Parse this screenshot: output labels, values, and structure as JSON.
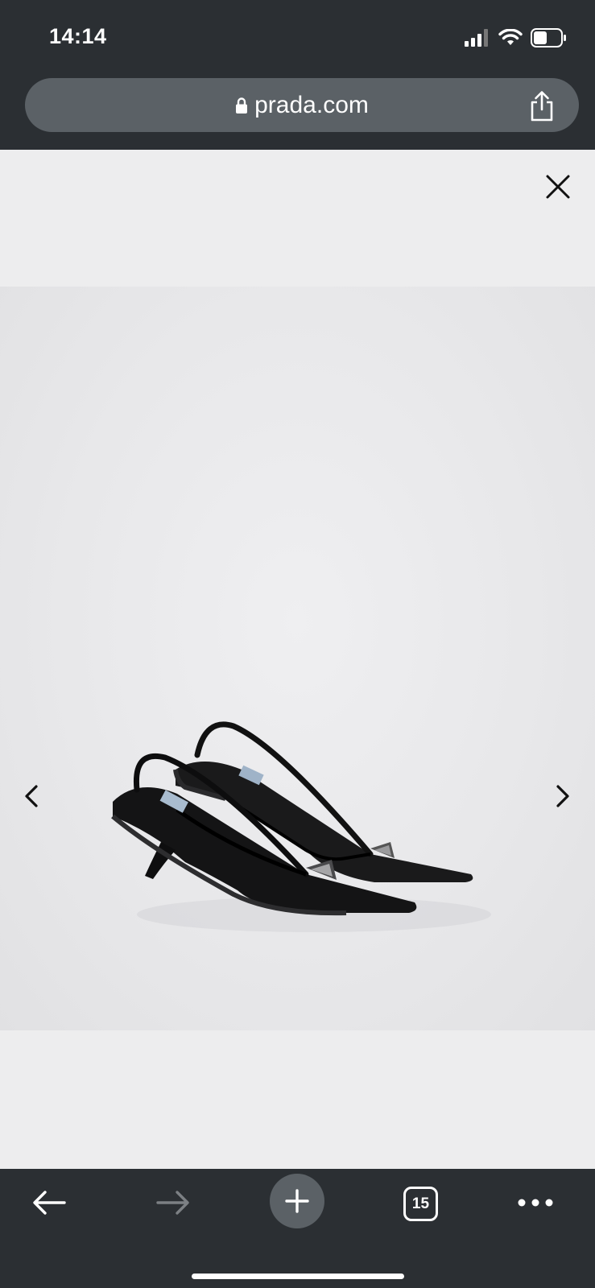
{
  "status_bar": {
    "time": "14:14",
    "icons": [
      "cellular-signal-icon",
      "wifi-icon",
      "battery-icon"
    ]
  },
  "browser": {
    "url": "prada.com",
    "lock_icon": "lock-icon",
    "share_icon": "share-icon"
  },
  "viewer": {
    "close_icon": "close-icon",
    "prev_icon": "chevron-left-icon",
    "next_icon": "chevron-right-icon",
    "image_subject": "black slingback pumps"
  },
  "toolbar": {
    "back_icon": "arrow-left-icon",
    "forward_icon": "arrow-right-icon",
    "new_tab_icon": "plus-icon",
    "tab_count": "15",
    "menu_icon": "more-dots-icon"
  },
  "colors": {
    "chrome_bg": "#2b2f33",
    "urlbar_bg": "#5b6166",
    "page_bg": "#ededee"
  }
}
